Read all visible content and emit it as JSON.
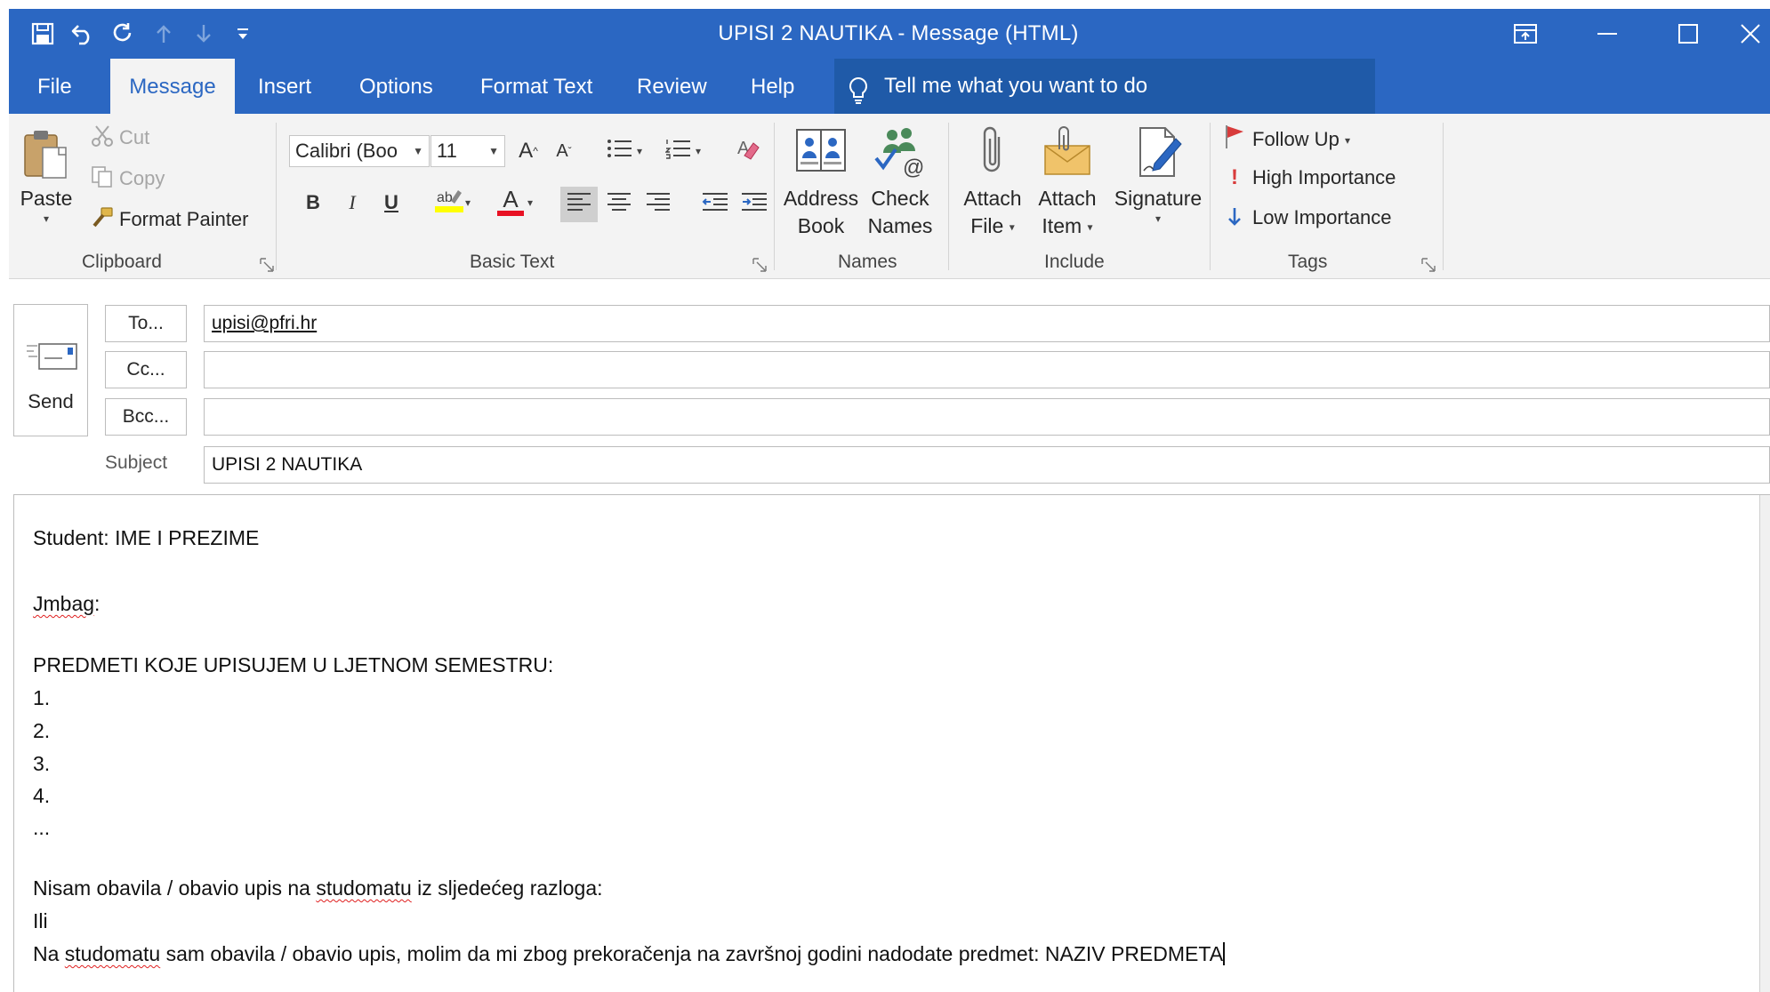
{
  "window": {
    "title": "UPISI 2 NAUTIKA  -  Message (HTML)"
  },
  "qat": {
    "icons": [
      "save-icon",
      "undo-icon",
      "redo-icon",
      "up-arrow-icon",
      "down-arrow-icon",
      "customize-icon"
    ]
  },
  "tabs": [
    {
      "label": "File"
    },
    {
      "label": "Message",
      "active": true
    },
    {
      "label": "Insert"
    },
    {
      "label": "Options"
    },
    {
      "label": "Format Text"
    },
    {
      "label": "Review"
    },
    {
      "label": "Help"
    }
  ],
  "tellme": {
    "label": "Tell me what you want to do"
  },
  "ribbon": {
    "clipboard": {
      "group": "Clipboard",
      "paste": "Paste",
      "cut": "Cut",
      "copy": "Copy",
      "format_painter": "Format Painter"
    },
    "basic_text": {
      "group": "Basic Text",
      "font": "Calibri (Boo",
      "size": "11",
      "grow": "A",
      "shrink": "A",
      "bold": "B",
      "italic": "I",
      "underline": "U",
      "font_color_letter": "A"
    },
    "names": {
      "group": "Names",
      "address_book_1": "Address",
      "address_book_2": "Book",
      "check_names_1": "Check",
      "check_names_2": "Names"
    },
    "include": {
      "group": "Include",
      "attach_file_1": "Attach",
      "attach_file_2": "File",
      "attach_item_1": "Attach",
      "attach_item_2": "Item",
      "signature": "Signature"
    },
    "tags": {
      "group": "Tags",
      "follow_up": "Follow Up",
      "high_importance": "High Importance",
      "low_importance": "Low Importance"
    }
  },
  "header": {
    "send": "Send",
    "to_button": "To...",
    "cc_button": "Cc...",
    "bcc_button": "Bcc...",
    "to_value": "upisi@pfri.hr",
    "cc_value": "",
    "bcc_value": "",
    "subject_label": "Subject",
    "subject_value": "UPISI 2 NAUTIKA"
  },
  "body": {
    "line1": "Student: IME I PREZIME",
    "jmbag_word": "Jmbag",
    "jmbag_colon": ":",
    "predmeti": "PREDMETI KOJE UPISUJEM U LJETNOM SEMESTRU:",
    "items": [
      "1.",
      "2.",
      "3.",
      "4."
    ],
    "ellipsis": "...",
    "nisam_before": "Nisam obavila / obavio upis na ",
    "studomatu": "studomatu",
    "nisam_after": " iz sljedećeg razloga:",
    "ili": "Ili",
    "na_before": "Na ",
    "na_after": " sam obavila / obavio upis, molim da mi zbog prekoračenja na završnoj godini nadodate predmet: NAZIV PREDMETA"
  },
  "colors": {
    "accent": "#2b67c2",
    "ribbon_bg": "#f3f3f3",
    "spell_error": "#e02020"
  }
}
